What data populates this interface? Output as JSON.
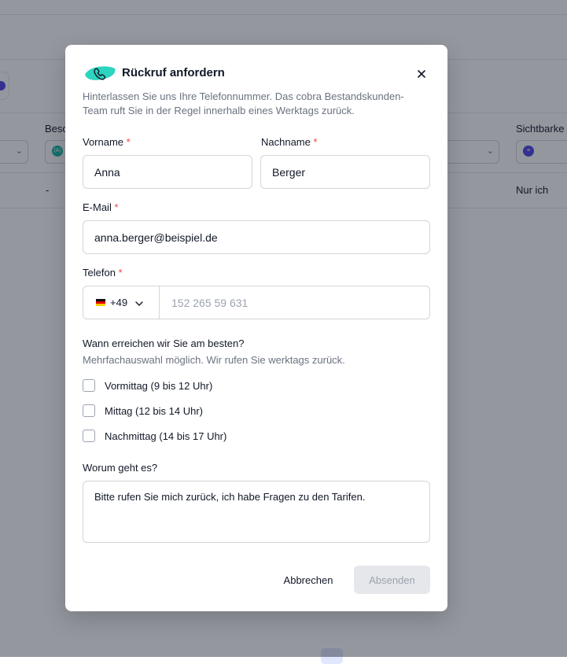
{
  "background": {
    "columns": [
      "Besc",
      "Sichtbarke"
    ],
    "row": {
      "col1": "-",
      "visibility": "Nur ich"
    },
    "badge_label": "(A)"
  },
  "modal": {
    "title": "Rückruf anfordern",
    "icon": "phone-icon",
    "close_icon": "close-icon",
    "description": "Hinterlassen Sie uns Ihre Telefonnummer. Das cobra Bestandskunden-Team ruft Sie in der Regel innerhalb eines Werktags zurück.",
    "required_marker": "*",
    "fields": {
      "firstname": {
        "label": "Vorname",
        "value": "Anna"
      },
      "lastname": {
        "label": "Nachname",
        "value": "Berger"
      },
      "email": {
        "label": "E-Mail",
        "value": "anna.berger@beispiel.de"
      },
      "phone": {
        "label": "Telefon",
        "dial_code": "+49",
        "placeholder": "152 265 59 631",
        "value": ""
      }
    },
    "availability": {
      "question": "Wann erreichen wir Sie am besten?",
      "hint": "Mehrfachauswahl möglich. Wir rufen Sie werktags zurück.",
      "options": [
        {
          "label": "Vormittag (9 bis 12 Uhr)",
          "checked": false
        },
        {
          "label": "Mittag (12 bis 14 Uhr)",
          "checked": false
        },
        {
          "label": "Nachmittag (14 bis 17 Uhr)",
          "checked": false
        }
      ]
    },
    "topic": {
      "label": "Worum geht es?",
      "value": "Bitte rufen Sie mich zurück, ich habe Fragen zu den Tarifen."
    },
    "buttons": {
      "cancel": "Abbrechen",
      "submit": "Absenden"
    }
  },
  "colors": {
    "accent": "#2dd4bf",
    "required": "#ef4444",
    "overlay": "rgba(17,24,39,0.45)",
    "submit_disabled_bg": "#e5e7eb"
  }
}
